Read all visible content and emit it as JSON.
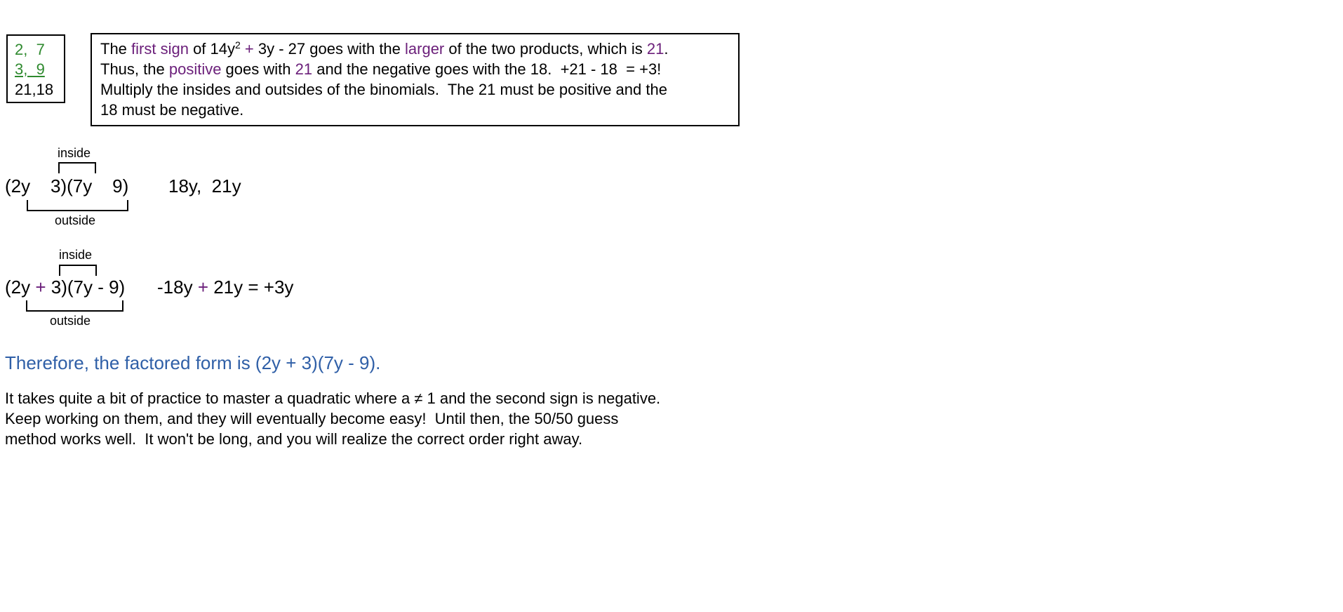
{
  "pairs_box": {
    "row1": "2,  7",
    "row2": "3,  9",
    "row3": "21,18"
  },
  "explanation": {
    "line1": {
      "a": "The ",
      "b": "first sign",
      "c": " of 14y",
      "sup": "2",
      "d": " ",
      "e": "+",
      "f": " 3y - 27 goes with the ",
      "g": "larger",
      "h": " of the two products, which is ",
      "i": "21",
      "j": "."
    },
    "line2": {
      "a": "Thus, the ",
      "b": "positive",
      "c": " goes with ",
      "d": "21",
      "e": " and the negative goes with the 18.  +21 - 18  = +3!"
    },
    "line3": "Multiply the insides and outsides of the binomials.  The 21 must be positive and the",
    "line4": "18 must be negative."
  },
  "diagram1": {
    "inside_label": "inside",
    "outside_label": "outside",
    "expression": "(2y    3)(7y    9)",
    "products": "18y,  21y"
  },
  "diagram2": {
    "inside_label": "inside",
    "outside_label": "outside",
    "expr_a": "(2y ",
    "expr_plus": "+",
    "expr_b": " 3)(7y - 9)",
    "result_a": "-18y ",
    "result_plus": "+",
    "result_b": " 21y = +3y"
  },
  "conclusion": "Therefore, the factored form is (2y + 3)(7y - 9).",
  "paragraph": {
    "line1": "It takes quite a bit of practice to master a quadratic where a ≠ 1 and the second sign is negative.",
    "line2": "Keep working on them, and they will eventually become easy!  Until then, the 50/50 guess",
    "line3": "method works well.  It won't be long, and you will realize the correct order right away."
  },
  "colors": {
    "highlight_purple": "#6b1f7a",
    "factor_green": "#2f8a2f",
    "conclusion_blue": "#2f5fa7"
  }
}
